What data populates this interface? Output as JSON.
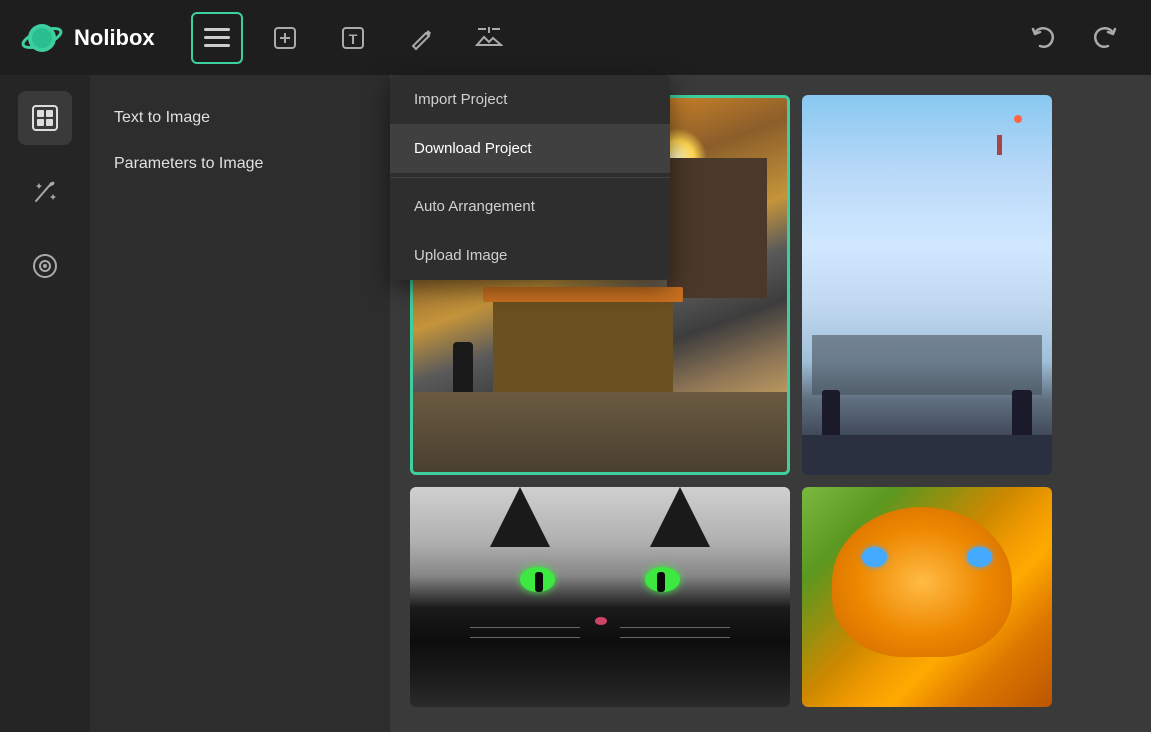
{
  "header": {
    "logo_text": "Nolibox",
    "buttons": [
      {
        "id": "menu",
        "label": "☰",
        "active": true,
        "aria": "menu-button"
      },
      {
        "id": "add",
        "label": "⊞",
        "active": false,
        "aria": "add-button"
      },
      {
        "id": "text",
        "label": "T",
        "active": false,
        "aria": "text-button"
      },
      {
        "id": "draw",
        "label": "✏",
        "active": false,
        "aria": "draw-button"
      },
      {
        "id": "image",
        "label": "⛰",
        "active": false,
        "aria": "image-button"
      }
    ],
    "undo_label": "↩",
    "redo_label": "↪"
  },
  "sidebar": {
    "items": [
      {
        "id": "gallery",
        "label": "🖼",
        "active": true
      },
      {
        "id": "magic",
        "label": "✏",
        "active": false
      },
      {
        "id": "circle",
        "label": "◎",
        "active": false
      }
    ]
  },
  "left_panel": {
    "items": [
      {
        "id": "text-to-image",
        "label": "Text to Image"
      },
      {
        "id": "params-to-image",
        "label": "Parameters to Image"
      }
    ]
  },
  "dropdown": {
    "items": [
      {
        "id": "import-project",
        "label": "Import Project",
        "highlighted": false
      },
      {
        "id": "download-project",
        "label": "Download Project",
        "highlighted": true
      },
      {
        "id": "auto-arrangement",
        "label": "Auto Arrangement",
        "highlighted": false
      },
      {
        "id": "upload-image",
        "label": "Upload Image",
        "highlighted": false
      }
    ]
  },
  "canvas": {
    "images": [
      {
        "id": "street",
        "alt": "Street market scene",
        "position": "top-left"
      },
      {
        "id": "anime",
        "alt": "Anime sky scene",
        "position": "top-right"
      },
      {
        "id": "cat",
        "alt": "Cat face closeup",
        "position": "bottom-left"
      },
      {
        "id": "cat2",
        "alt": "Orange cat",
        "position": "bottom-right"
      }
    ]
  },
  "colors": {
    "accent": "#3ecfa0",
    "header_bg": "#1e1e1e",
    "sidebar_bg": "#252525",
    "panel_bg": "#2d2d2d",
    "canvas_bg": "#3a3a3a",
    "dropdown_bg": "#2e2e2e",
    "dropdown_highlight": "#404040"
  }
}
